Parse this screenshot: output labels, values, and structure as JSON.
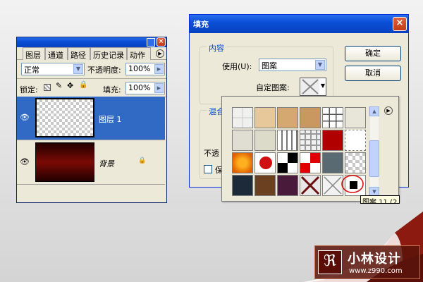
{
  "layers_panel": {
    "tabs": [
      "图层",
      "通道",
      "路径",
      "历史记录",
      "动作"
    ],
    "blend_mode": "正常",
    "opacity_label": "不透明度:",
    "opacity_value": "100%",
    "lock_label": "锁定:",
    "fill_label": "填充:",
    "fill_value": "100%",
    "layers": [
      {
        "name": "图层 1",
        "selected": true
      },
      {
        "name": "背景",
        "selected": false
      }
    ]
  },
  "fill_dialog": {
    "title": "填充",
    "contents_legend": "内容",
    "use_label": "使用(U):",
    "use_value": "图案",
    "custom_pattern_label": "自定图案:",
    "blending_legend": "混合",
    "opacity_label_partial": "不透",
    "preserve_partial": "保",
    "ok_button": "确定",
    "cancel_button": "取消"
  },
  "pattern_picker": {
    "tooltip": "图案 11 (2"
  },
  "watermark": {
    "name": "小林设计",
    "url": "www.z990.com"
  },
  "colors": {
    "title_blue": "#0a4fd6",
    "selection_blue": "#316ac5",
    "annotation_red": "#e01010"
  }
}
